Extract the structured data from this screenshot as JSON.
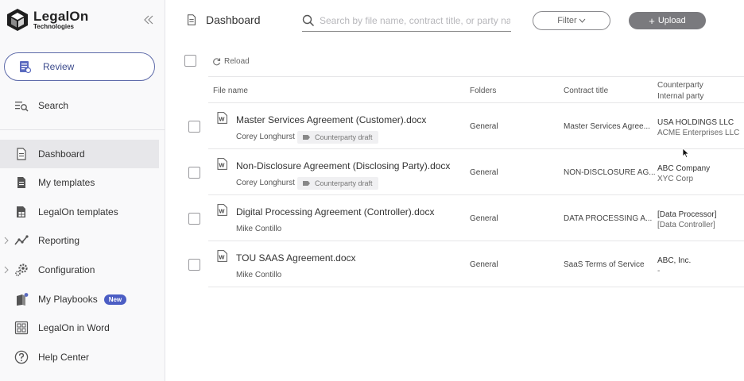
{
  "brand": {
    "name": "LegalOn",
    "sub": "Technologies"
  },
  "sidebar": {
    "review_label": "Review",
    "search_label": "Search",
    "items": [
      {
        "label": "Dashboard",
        "icon": "document-icon",
        "active": true
      },
      {
        "label": "My templates",
        "icon": "template-icon"
      },
      {
        "label": "LegalOn templates",
        "icon": "templates-grid-icon"
      },
      {
        "label": "Reporting",
        "icon": "trend-icon"
      },
      {
        "label": "Configuration",
        "icon": "gear-icon"
      },
      {
        "label": "My Playbooks",
        "icon": "playbook-icon",
        "badge": "New"
      },
      {
        "label": "LegalOn in Word",
        "icon": "word-grid-icon"
      },
      {
        "label": "Help Center",
        "icon": "help-icon"
      }
    ]
  },
  "header": {
    "title": "Dashboard",
    "search_placeholder": "Search by file name, contract title, or party name",
    "filter_label": "Filter",
    "upload_label": "Upload"
  },
  "toolbar": {
    "reload_label": "Reload"
  },
  "table": {
    "columns": {
      "file_name": "File name",
      "folders": "Folders",
      "contract_title": "Contract title",
      "counterparty": "Counterparty",
      "internal_party": "Internal party"
    },
    "rows": [
      {
        "file": "Master Services Agreement (Customer).docx",
        "owner": "Corey Longhurst",
        "tag": "Counterparty draft",
        "folder": "General",
        "contract_title": "Master Services Agree...",
        "counterparty": "USA HOLDINGS LLC",
        "internal_party": "ACME Enterprises LLC"
      },
      {
        "file": "Non-Disclosure Agreement (Disclosing Party).docx",
        "owner": "Corey Longhurst",
        "tag": "Counterparty draft",
        "folder": "General",
        "contract_title": "NON-DISCLOSURE AG...",
        "counterparty": "ABC Company",
        "internal_party": "XYC Corp"
      },
      {
        "file": "Digital Processing Agreement (Controller).docx",
        "owner": "Mike Contillo",
        "tag": "",
        "folder": "General",
        "contract_title": "DATA PROCESSING A...",
        "counterparty": "[Data Processor]",
        "internal_party": "[Data Controller]"
      },
      {
        "file": "TOU SAAS Agreement.docx",
        "owner": "Mike Contillo",
        "tag": "",
        "folder": "General",
        "contract_title": "SaaS Terms of Service",
        "counterparty": "ABC, Inc.",
        "internal_party": "-"
      }
    ]
  },
  "colors": {
    "accent": "#4c5ec4",
    "review_border": "#5d6aa9",
    "upload_bg": "#7a7a7e",
    "active_nav": "#e7e7ea"
  }
}
